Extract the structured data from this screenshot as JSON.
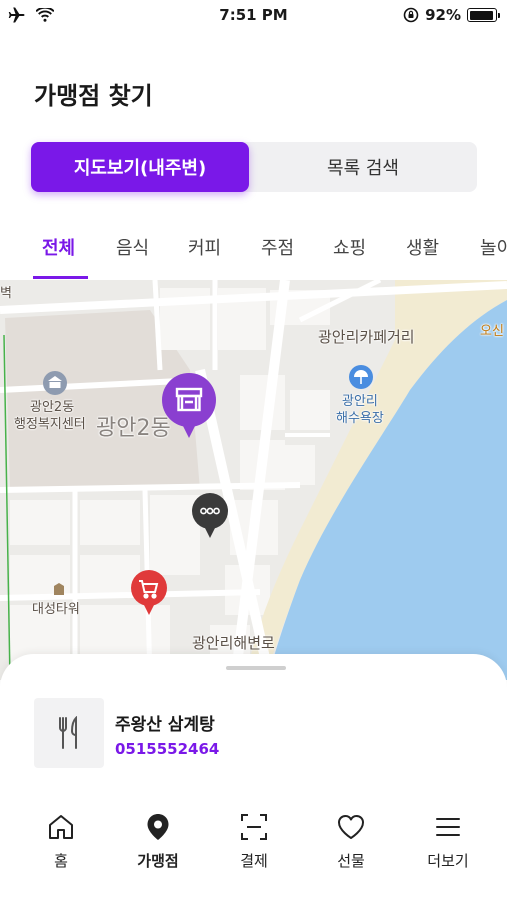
{
  "status_bar": {
    "time": "7:51 PM",
    "battery": "92%",
    "battery_level": 0.92
  },
  "page_title": "가맹점 찾기",
  "view_toggle": {
    "map_label": "지도보기(내주변)",
    "list_label": "목록 검색"
  },
  "categories": [
    "전체",
    "음식",
    "커피",
    "주점",
    "쇼핑",
    "생활",
    "놀이"
  ],
  "active_category": "전체",
  "map": {
    "labels": {
      "top_left": "벽",
      "cafe_street": "광안리카페거리",
      "osin": "오신",
      "office_line1": "광안2동",
      "office_line2": "행정복지센터",
      "district": "광안2동",
      "beach_line1": "광안리",
      "beach_line2": "해수욕장",
      "tower": "대성타워",
      "beach_road": "광안리해변로"
    },
    "markers": [
      {
        "name": "store-marker",
        "color": "#8a3fd0",
        "icon": "storefront-icon"
      },
      {
        "name": "more-marker",
        "color": "#3a3a3a",
        "icon": "ellipsis-icon"
      },
      {
        "name": "shopping-marker",
        "color": "#e03a3a",
        "icon": "cart-icon"
      }
    ]
  },
  "selected_store": {
    "name": "주왕산 삼계탕",
    "phone": "0515552464",
    "icon": "fork-knife-icon"
  },
  "nav": [
    {
      "label": "홈",
      "icon": "home-icon"
    },
    {
      "label": "가맹점",
      "icon": "location-pin-icon",
      "active": true
    },
    {
      "label": "결제",
      "icon": "scan-icon"
    },
    {
      "label": "선물",
      "icon": "heart-icon"
    },
    {
      "label": "더보기",
      "icon": "menu-icon"
    }
  ],
  "colors": {
    "accent": "#7a18e8",
    "map_water": "#9ecbef",
    "map_sand": "#f2ebd2"
  }
}
